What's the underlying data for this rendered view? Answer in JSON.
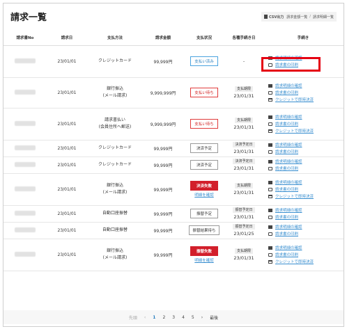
{
  "page": {
    "title": "請求一覧"
  },
  "breadcrumb": {
    "csv_label": "CSV出力",
    "crumb1": "請求金額一覧",
    "separator": "/",
    "crumb2": "請求明細一覧"
  },
  "table": {
    "headers": [
      "請求書No",
      "請求日",
      "支払方法",
      "請求金額",
      "支払状況",
      "各種手続き日",
      "手続き"
    ],
    "rows": [
      {
        "date": "23/01/01",
        "method1": "クレジットカード",
        "method2": "",
        "amount": "99,999円",
        "status": "支払い済み",
        "status_sub": "",
        "due_label": "",
        "due_date": "-",
        "actions": [
          "請求明細の確認",
          "請求書の印刷"
        ]
      },
      {
        "date": "23/01/01",
        "method1": "銀行振込",
        "method2": "(メール請求)",
        "amount": "9,999,999円",
        "status": "支払い待ち",
        "status_sub": "",
        "due_label": "支払期限",
        "due_date": "23/01/31",
        "actions": [
          "請求明細の確認",
          "請求書の印刷",
          "クレジットで即時決済"
        ]
      },
      {
        "date": "23/01/01",
        "method1": "請求書払い",
        "method2": "(会員住所へ郵送)",
        "amount": "9,999,999円",
        "status": "支払い待ち",
        "status_sub": "",
        "due_label": "支払期限",
        "due_date": "23/01/31",
        "actions": [
          "請求明細の確認",
          "請求書の印刷",
          "クレジットで即時決済"
        ]
      },
      {
        "date": "23/01/01",
        "method1": "クレジットカード",
        "method2": "",
        "amount": "99,999円",
        "status": "決済予定",
        "status_sub": "",
        "due_label": "決済予定日",
        "due_date": "23/01/31",
        "actions": [
          "請求明細の確認",
          "請求書の印刷"
        ]
      },
      {
        "date": "23/01/01",
        "method1": "クレジットカード",
        "method2": "",
        "amount": "99,999円",
        "status": "決済予定",
        "status_sub": "",
        "due_label": "決済予定日",
        "due_date": "23/01/31",
        "actions": [
          "請求明細の確認",
          "請求書の印刷"
        ]
      },
      {
        "date": "23/01/01",
        "method1": "銀行振込",
        "method2": "(メール請求)",
        "amount": "99,999円",
        "status": "決済失敗",
        "status_sub": "明細を確認",
        "due_label": "支払期限",
        "due_date": "23/01/31",
        "actions": [
          "請求明細の確認",
          "請求書の印刷",
          "クレジットで即時決済"
        ]
      },
      {
        "date": "23/01/01",
        "method1": "自動口座振替",
        "method2": "",
        "amount": "99,999円",
        "status": "振替予定",
        "status_sub": "",
        "due_label": "振替予定日",
        "due_date": "23/01/31",
        "actions": [
          "請求明細の確認",
          "請求書の印刷"
        ]
      },
      {
        "date": "23/01/01",
        "method1": "自動口座振替",
        "method2": "",
        "amount": "99,999円",
        "status": "振替結果待ち",
        "status_sub": "",
        "due_label": "振替予定日",
        "due_date": "23/01/25",
        "actions": [
          "請求明細の確認",
          "請求書の印刷"
        ]
      },
      {
        "date": "23/01/01",
        "method1": "銀行振込",
        "method2": "(メール請求)",
        "amount": "99,999円",
        "status": "振替失敗",
        "status_sub": "明細を確認",
        "due_label": "支払期限",
        "due_date": "23/01/31",
        "actions": [
          "請求明細の確認",
          "請求書の印刷",
          "クレジットで即時決済"
        ]
      }
    ]
  },
  "pagination": {
    "first": "先頭",
    "prev": "‹",
    "pages": [
      "1",
      "2",
      "3",
      "4",
      "5"
    ],
    "next": "›",
    "last": "最後",
    "current": "1"
  },
  "colors": {
    "accent_red": "#d21f2b",
    "link_blue": "#3a8fd0",
    "highlight": "#e50012"
  }
}
